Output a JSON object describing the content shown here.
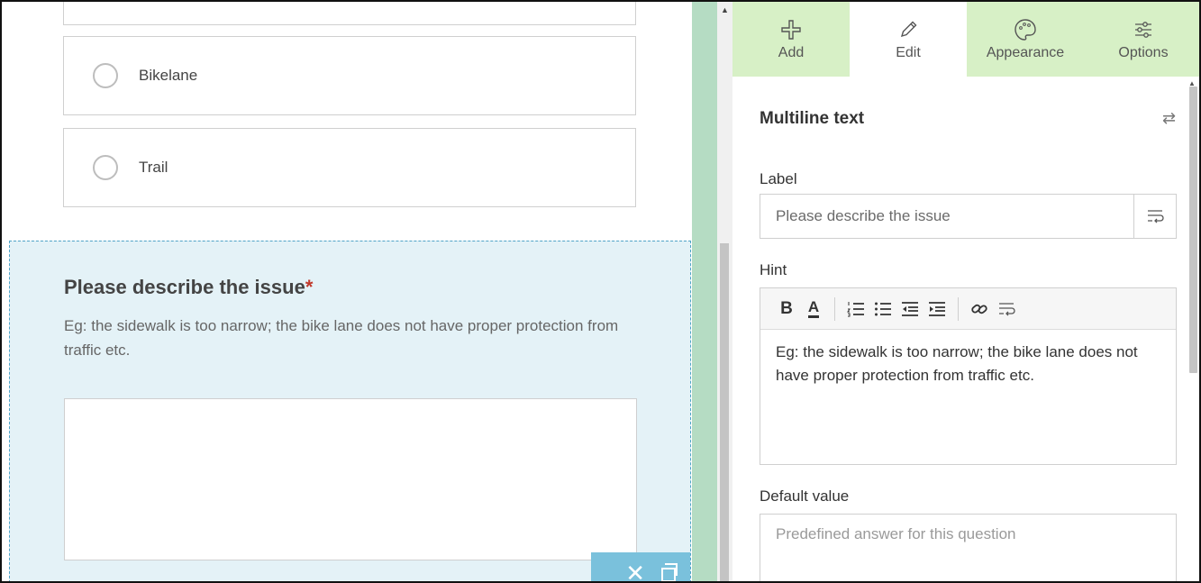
{
  "form": {
    "choices": [
      {
        "label": "Bikelane"
      },
      {
        "label": "Trail"
      }
    ],
    "question": {
      "title": "Please describe the issue",
      "required_mark": "*",
      "hint": "Eg: the sidewalk is too narrow; the bike lane does not have proper protection from traffic etc."
    }
  },
  "panel": {
    "tabs": [
      {
        "label": "Add",
        "icon": "plus-icon"
      },
      {
        "label": "Edit",
        "icon": "pencil-icon"
      },
      {
        "label": "Appearance",
        "icon": "palette-icon"
      },
      {
        "label": "Options",
        "icon": "sliders-icon"
      }
    ],
    "active_tab": "Edit",
    "title": "Multiline text",
    "label_field": {
      "label": "Label",
      "value": "Please describe the issue"
    },
    "hint_field": {
      "label": "Hint",
      "toolbar": [
        "bold",
        "font-color",
        "numbered-list",
        "bullet-list",
        "outdent",
        "indent",
        "link",
        "wrap"
      ],
      "value": "Eg: the sidewalk is too narrow; the bike lane does not have proper protection from traffic etc."
    },
    "default_field": {
      "label": "Default value",
      "placeholder": "Predefined answer for this question"
    }
  },
  "colors": {
    "tab_bg": "#d7f0c6",
    "divider": "#b5dcc3",
    "selected_question_bg": "#e4f2f7",
    "tool_bar": "#7ac1dc",
    "required": "#c0392b"
  }
}
